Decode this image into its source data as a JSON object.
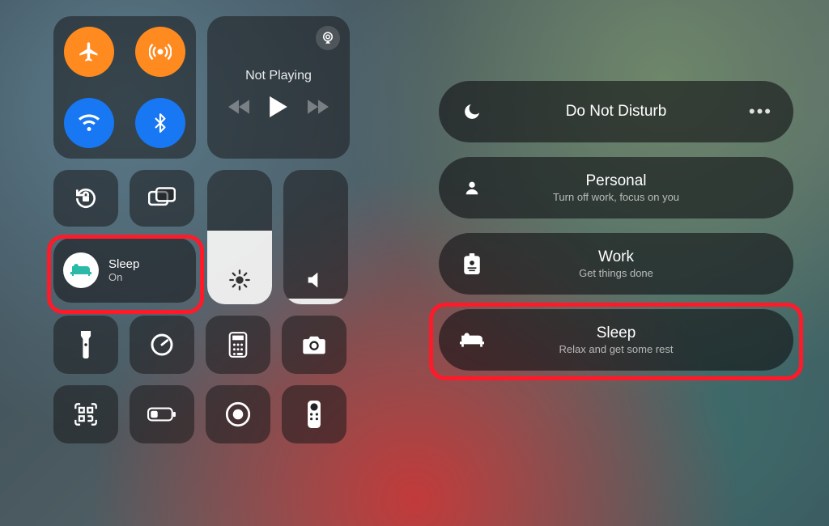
{
  "left": {
    "media": {
      "status": "Not Playing"
    },
    "focus": {
      "title": "Sleep",
      "status": "On"
    },
    "brightness_pct": 55,
    "volume_pct": 4
  },
  "right": {
    "items": [
      {
        "title": "Do Not Disturb",
        "subtitle": ""
      },
      {
        "title": "Personal",
        "subtitle": "Turn off work, focus on you"
      },
      {
        "title": "Work",
        "subtitle": "Get things done"
      },
      {
        "title": "Sleep",
        "subtitle": "Relax and get some rest"
      }
    ]
  }
}
